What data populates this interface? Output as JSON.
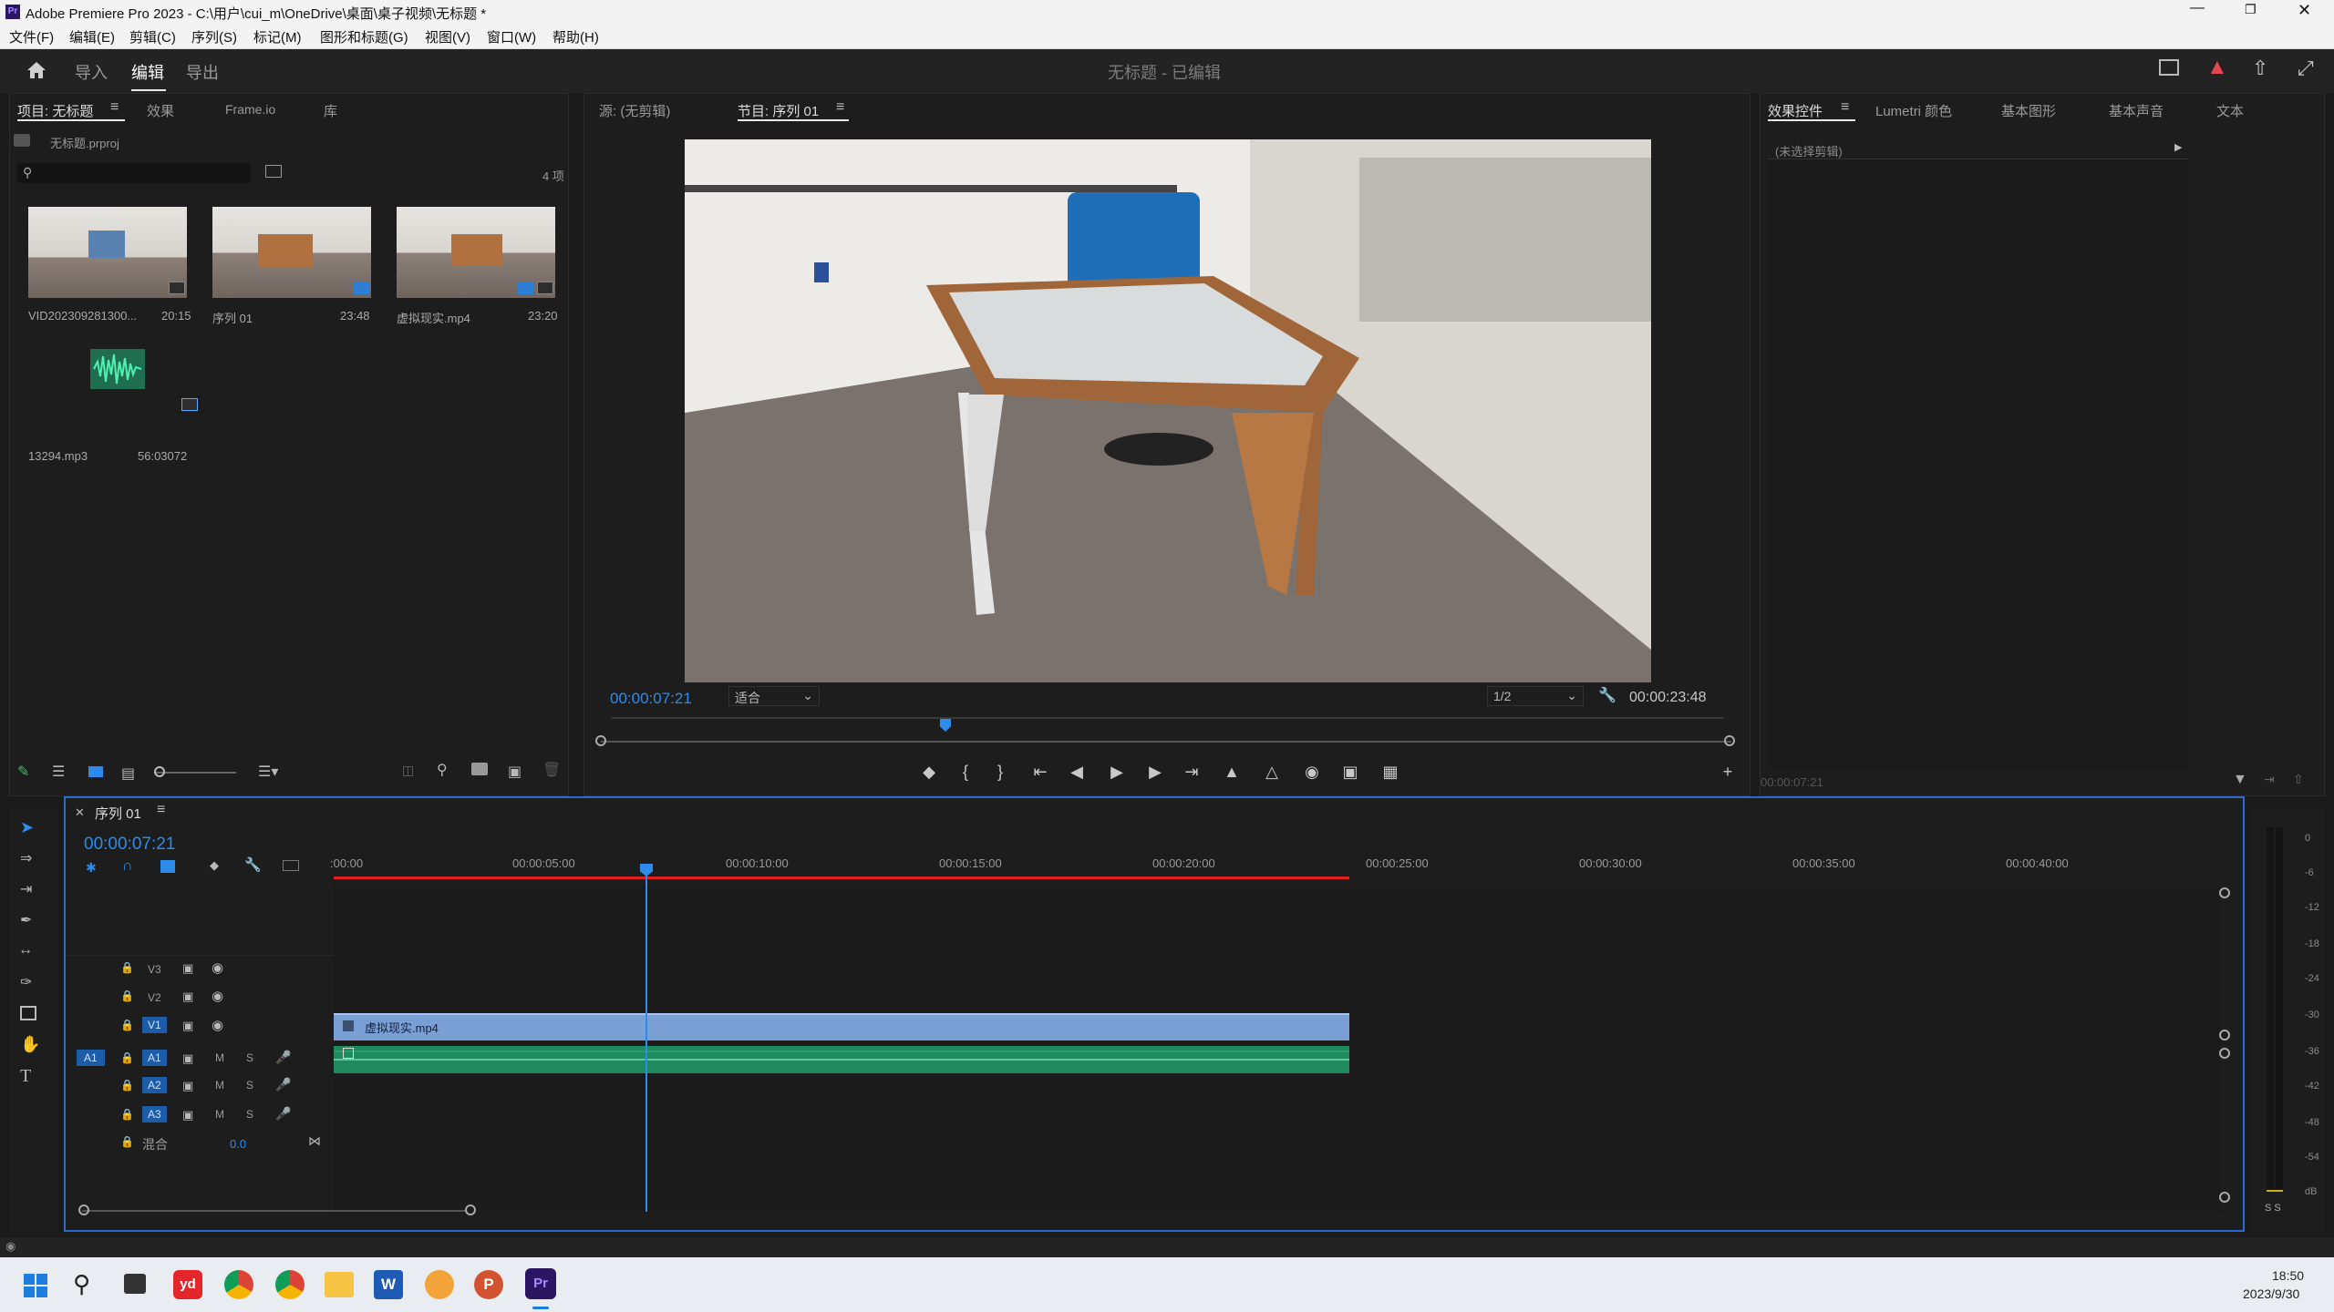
{
  "window": {
    "title": "Adobe Premiere Pro 2023 - C:\\用户\\cui_m\\OneDrive\\桌面\\桌子视频\\无标题 *"
  },
  "menu": [
    "文件(F)",
    "编辑(E)",
    "剪辑(C)",
    "序列(S)",
    "标记(M)",
    "图形和标题(G)",
    "视图(V)",
    "窗口(W)",
    "帮助(H)"
  ],
  "workspace": {
    "tabs": [
      "导入",
      "编辑",
      "导出"
    ],
    "active": "编辑",
    "doc_title": "无标题 - 已编辑"
  },
  "project": {
    "tabs": [
      "项目: 无标题",
      "效果",
      "Frame.io",
      "库"
    ],
    "file": "无标题.prproj",
    "count": "4 项",
    "items": [
      {
        "name": "VID202309281300...",
        "duration": "20:15"
      },
      {
        "name": "序列 01",
        "duration": "23:48"
      },
      {
        "name": "虚拟现实.mp4",
        "duration": "23:20"
      },
      {
        "name": "13294.mp3",
        "duration": "56:03072"
      }
    ]
  },
  "monitor": {
    "tabs": [
      "源: (无剪辑)",
      "节目: 序列 01"
    ],
    "timecode": "00:00:07:21",
    "fit": "适合",
    "resolution": "1/2",
    "duration": "00:00:23:48"
  },
  "effects": {
    "tabs": [
      "效果控件",
      "Lumetri 颜色",
      "基本图形",
      "基本声音",
      "文本"
    ],
    "no_clip": "(未选择剪辑)",
    "timecode": "00:00:07:21"
  },
  "timeline": {
    "tab": "序列 01",
    "timecode": "00:00:07:21",
    "ruler": [
      ":00:00",
      "00:00:05:00",
      "00:00:10:00",
      "00:00:15:00",
      "00:00:20:00",
      "00:00:25:00",
      "00:00:30:00",
      "00:00:35:00",
      "00:00:40:00"
    ],
    "video_tracks": [
      "V3",
      "V2",
      "V1"
    ],
    "audio_tracks": [
      "A1",
      "A2",
      "A3"
    ],
    "source_patch_v": "V1",
    "source_patch_a": "A1",
    "mix_label": "混合",
    "mix_value": "0.0",
    "video_clip": "虚拟现实.mp4",
    "mute": "M",
    "solo": "S",
    "playhead_fraction": 0.31,
    "clip_end_fraction": 0.567
  },
  "meter": {
    "labels": [
      "0",
      "-6",
      "-12",
      "-18",
      "-24",
      "-30",
      "-36",
      "-42",
      "-48",
      "-54",
      "dB"
    ],
    "solo": "S  S"
  },
  "taskbar": {
    "time": "18:50",
    "date": "2023/9/30"
  },
  "colors": {
    "accent": "#2d8ceb",
    "video_clip": "#7a9fd4",
    "audio_clip": "#1f8a5e",
    "workarea": "#e0201d"
  }
}
